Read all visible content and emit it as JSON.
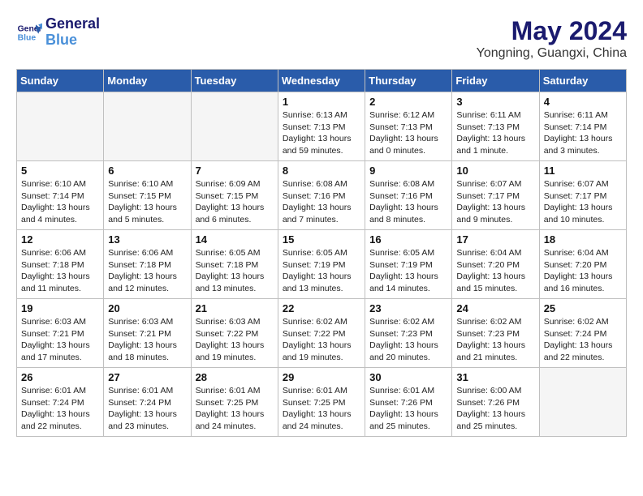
{
  "logo": {
    "line1": "General",
    "line2": "Blue"
  },
  "title": "May 2024",
  "subtitle": "Yongning, Guangxi, China",
  "weekdays": [
    "Sunday",
    "Monday",
    "Tuesday",
    "Wednesday",
    "Thursday",
    "Friday",
    "Saturday"
  ],
  "weeks": [
    [
      {
        "day": "",
        "info": ""
      },
      {
        "day": "",
        "info": ""
      },
      {
        "day": "",
        "info": ""
      },
      {
        "day": "1",
        "info": "Sunrise: 6:13 AM\nSunset: 7:13 PM\nDaylight: 13 hours\nand 59 minutes."
      },
      {
        "day": "2",
        "info": "Sunrise: 6:12 AM\nSunset: 7:13 PM\nDaylight: 13 hours\nand 0 minutes."
      },
      {
        "day": "3",
        "info": "Sunrise: 6:11 AM\nSunset: 7:13 PM\nDaylight: 13 hours\nand 1 minute."
      },
      {
        "day": "4",
        "info": "Sunrise: 6:11 AM\nSunset: 7:14 PM\nDaylight: 13 hours\nand 3 minutes."
      }
    ],
    [
      {
        "day": "5",
        "info": "Sunrise: 6:10 AM\nSunset: 7:14 PM\nDaylight: 13 hours\nand 4 minutes."
      },
      {
        "day": "6",
        "info": "Sunrise: 6:10 AM\nSunset: 7:15 PM\nDaylight: 13 hours\nand 5 minutes."
      },
      {
        "day": "7",
        "info": "Sunrise: 6:09 AM\nSunset: 7:15 PM\nDaylight: 13 hours\nand 6 minutes."
      },
      {
        "day": "8",
        "info": "Sunrise: 6:08 AM\nSunset: 7:16 PM\nDaylight: 13 hours\nand 7 minutes."
      },
      {
        "day": "9",
        "info": "Sunrise: 6:08 AM\nSunset: 7:16 PM\nDaylight: 13 hours\nand 8 minutes."
      },
      {
        "day": "10",
        "info": "Sunrise: 6:07 AM\nSunset: 7:17 PM\nDaylight: 13 hours\nand 9 minutes."
      },
      {
        "day": "11",
        "info": "Sunrise: 6:07 AM\nSunset: 7:17 PM\nDaylight: 13 hours\nand 10 minutes."
      }
    ],
    [
      {
        "day": "12",
        "info": "Sunrise: 6:06 AM\nSunset: 7:18 PM\nDaylight: 13 hours\nand 11 minutes."
      },
      {
        "day": "13",
        "info": "Sunrise: 6:06 AM\nSunset: 7:18 PM\nDaylight: 13 hours\nand 12 minutes."
      },
      {
        "day": "14",
        "info": "Sunrise: 6:05 AM\nSunset: 7:18 PM\nDaylight: 13 hours\nand 13 minutes."
      },
      {
        "day": "15",
        "info": "Sunrise: 6:05 AM\nSunset: 7:19 PM\nDaylight: 13 hours\nand 13 minutes."
      },
      {
        "day": "16",
        "info": "Sunrise: 6:05 AM\nSunset: 7:19 PM\nDaylight: 13 hours\nand 14 minutes."
      },
      {
        "day": "17",
        "info": "Sunrise: 6:04 AM\nSunset: 7:20 PM\nDaylight: 13 hours\nand 15 minutes."
      },
      {
        "day": "18",
        "info": "Sunrise: 6:04 AM\nSunset: 7:20 PM\nDaylight: 13 hours\nand 16 minutes."
      }
    ],
    [
      {
        "day": "19",
        "info": "Sunrise: 6:03 AM\nSunset: 7:21 PM\nDaylight: 13 hours\nand 17 minutes."
      },
      {
        "day": "20",
        "info": "Sunrise: 6:03 AM\nSunset: 7:21 PM\nDaylight: 13 hours\nand 18 minutes."
      },
      {
        "day": "21",
        "info": "Sunrise: 6:03 AM\nSunset: 7:22 PM\nDaylight: 13 hours\nand 19 minutes."
      },
      {
        "day": "22",
        "info": "Sunrise: 6:02 AM\nSunset: 7:22 PM\nDaylight: 13 hours\nand 19 minutes."
      },
      {
        "day": "23",
        "info": "Sunrise: 6:02 AM\nSunset: 7:23 PM\nDaylight: 13 hours\nand 20 minutes."
      },
      {
        "day": "24",
        "info": "Sunrise: 6:02 AM\nSunset: 7:23 PM\nDaylight: 13 hours\nand 21 minutes."
      },
      {
        "day": "25",
        "info": "Sunrise: 6:02 AM\nSunset: 7:24 PM\nDaylight: 13 hours\nand 22 minutes."
      }
    ],
    [
      {
        "day": "26",
        "info": "Sunrise: 6:01 AM\nSunset: 7:24 PM\nDaylight: 13 hours\nand 22 minutes."
      },
      {
        "day": "27",
        "info": "Sunrise: 6:01 AM\nSunset: 7:24 PM\nDaylight: 13 hours\nand 23 minutes."
      },
      {
        "day": "28",
        "info": "Sunrise: 6:01 AM\nSunset: 7:25 PM\nDaylight: 13 hours\nand 24 minutes."
      },
      {
        "day": "29",
        "info": "Sunrise: 6:01 AM\nSunset: 7:25 PM\nDaylight: 13 hours\nand 24 minutes."
      },
      {
        "day": "30",
        "info": "Sunrise: 6:01 AM\nSunset: 7:26 PM\nDaylight: 13 hours\nand 25 minutes."
      },
      {
        "day": "31",
        "info": "Sunrise: 6:00 AM\nSunset: 7:26 PM\nDaylight: 13 hours\nand 25 minutes."
      },
      {
        "day": "",
        "info": ""
      }
    ]
  ]
}
